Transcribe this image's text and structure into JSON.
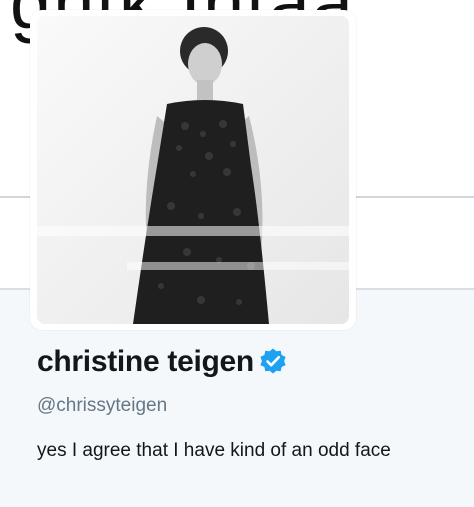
{
  "header": {
    "banner_text": "ghtk Intaa"
  },
  "profile": {
    "display_name": "christine teigen",
    "verified": true,
    "verified_badge_icon": "verified-check-icon",
    "accent_color": "#1da1f2",
    "handle": "@chrissyteigen",
    "bio": "yes I agree that I have kind of an odd face",
    "avatar_icon": "profile-photo"
  }
}
